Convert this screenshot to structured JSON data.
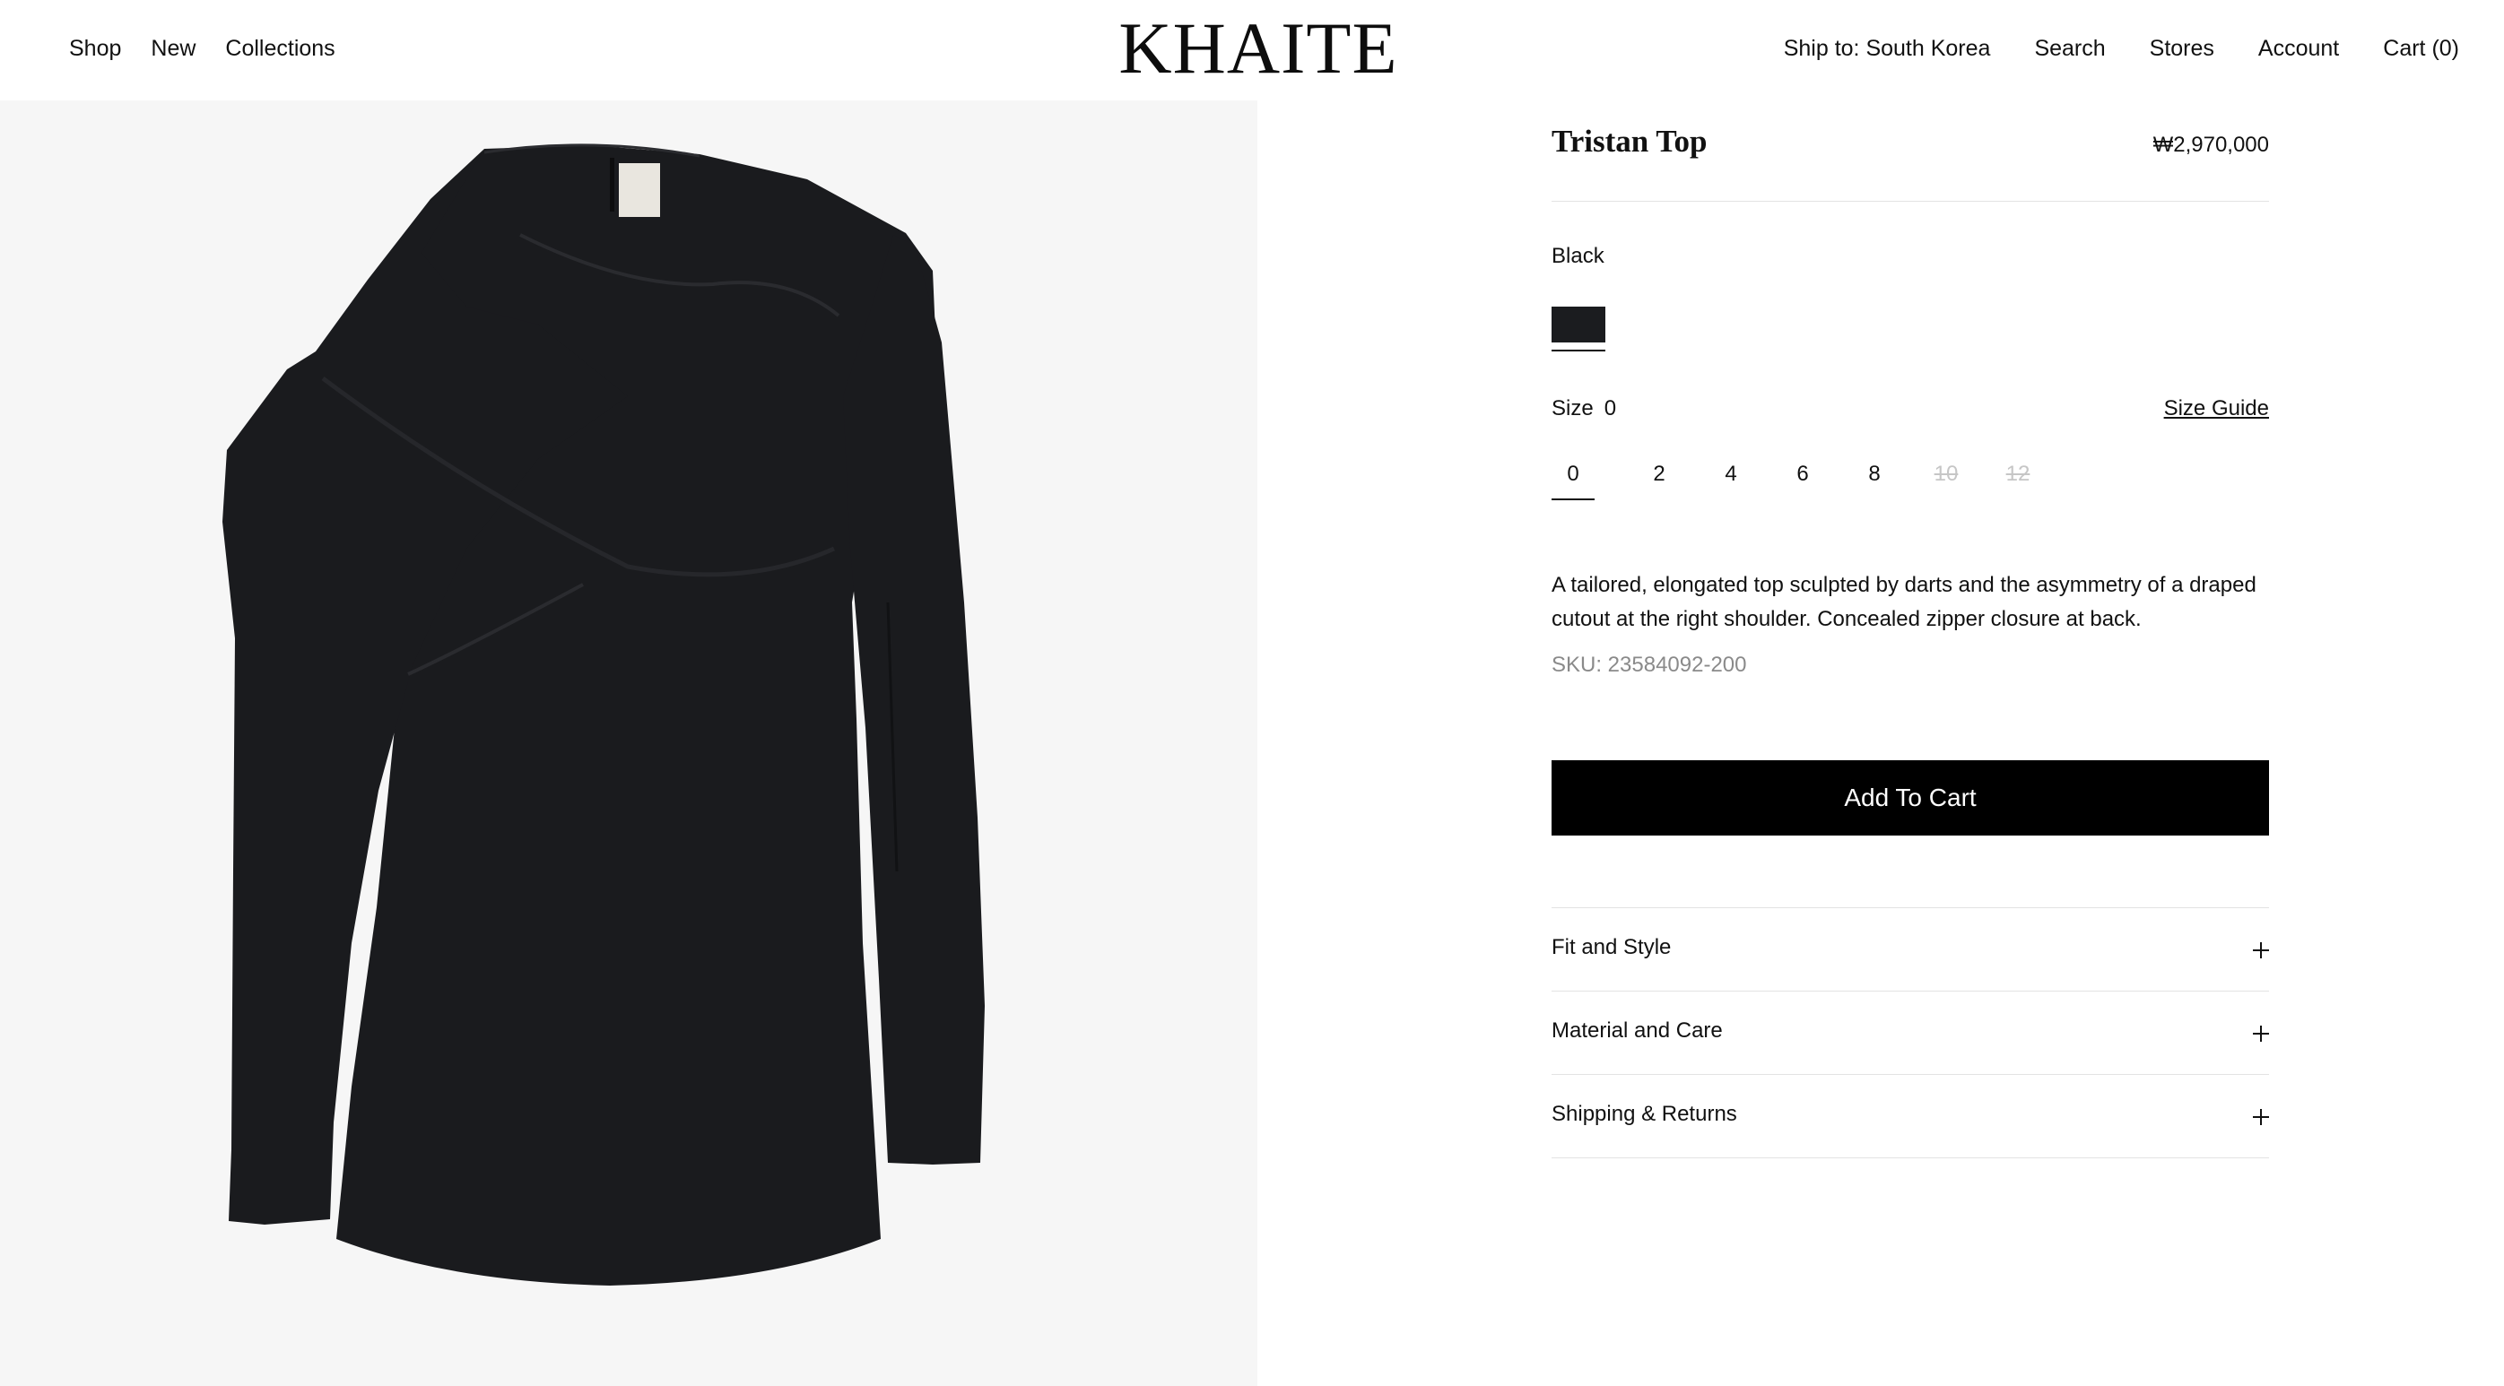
{
  "header": {
    "nav_left": [
      "Shop",
      "New",
      "Collections"
    ],
    "logo": "KHAITE",
    "ship_to": "Ship to: South Korea",
    "search": "Search",
    "stores": "Stores",
    "account": "Account",
    "cart": "Cart (0)"
  },
  "product": {
    "title": "Tristan Top",
    "price": "₩2,970,000",
    "color": "Black",
    "swatch_color": "#1b1c1f",
    "size_label": "Size",
    "size_selected": "0",
    "size_guide": "Size Guide",
    "sizes": [
      {
        "label": "0",
        "available": true,
        "selected": true
      },
      {
        "label": "2",
        "available": true,
        "selected": false
      },
      {
        "label": "4",
        "available": true,
        "selected": false
      },
      {
        "label": "6",
        "available": true,
        "selected": false
      },
      {
        "label": "8",
        "available": true,
        "selected": false
      },
      {
        "label": "10",
        "available": false,
        "selected": false
      },
      {
        "label": "12",
        "available": false,
        "selected": false
      }
    ],
    "description": "A tailored, elongated top sculpted by darts and the asymmetry of a draped cutout at the right shoulder. Concealed zipper closure at back.",
    "sku": "SKU: 23584092-200",
    "add_to_cart": "Add To Cart",
    "accordion": [
      "Fit and Style",
      "Material and Care",
      "Shipping & Returns"
    ]
  },
  "colors": {
    "image_background": "#f6f6f6",
    "garment": "#1a1b1e",
    "button": "#000000"
  }
}
